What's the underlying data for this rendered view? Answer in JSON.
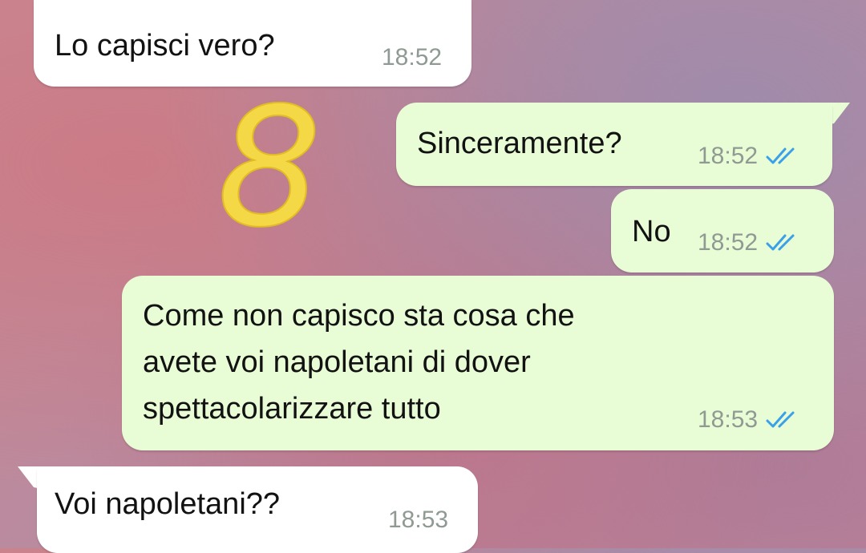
{
  "messages": [
    {
      "text": "Lo capisci vero?",
      "time": "18:52",
      "direction": "incoming"
    },
    {
      "text": "Sinceramente?",
      "time": "18:52",
      "direction": "outgoing",
      "status": "read"
    },
    {
      "text": "No",
      "time": "18:52",
      "direction": "outgoing",
      "status": "read"
    },
    {
      "text": "Come non capisco sta cosa che\navete voi napoletani di dover\nspettacolarizzare tutto",
      "time": "18:53",
      "direction": "outgoing",
      "status": "read"
    },
    {
      "text": "Voi napoletani??",
      "time": "18:53",
      "direction": "incoming"
    }
  ],
  "annotation": {
    "text": "8",
    "color": "#f5d846"
  },
  "colors": {
    "incoming_bubble": "#ffffff",
    "outgoing_bubble": "#e8fcd6",
    "message_text": "#121212",
    "timestamp": "#8f9a93",
    "read_ticks": "#3aa0e8"
  },
  "icons": {
    "read_receipt": "double-check-icon"
  }
}
